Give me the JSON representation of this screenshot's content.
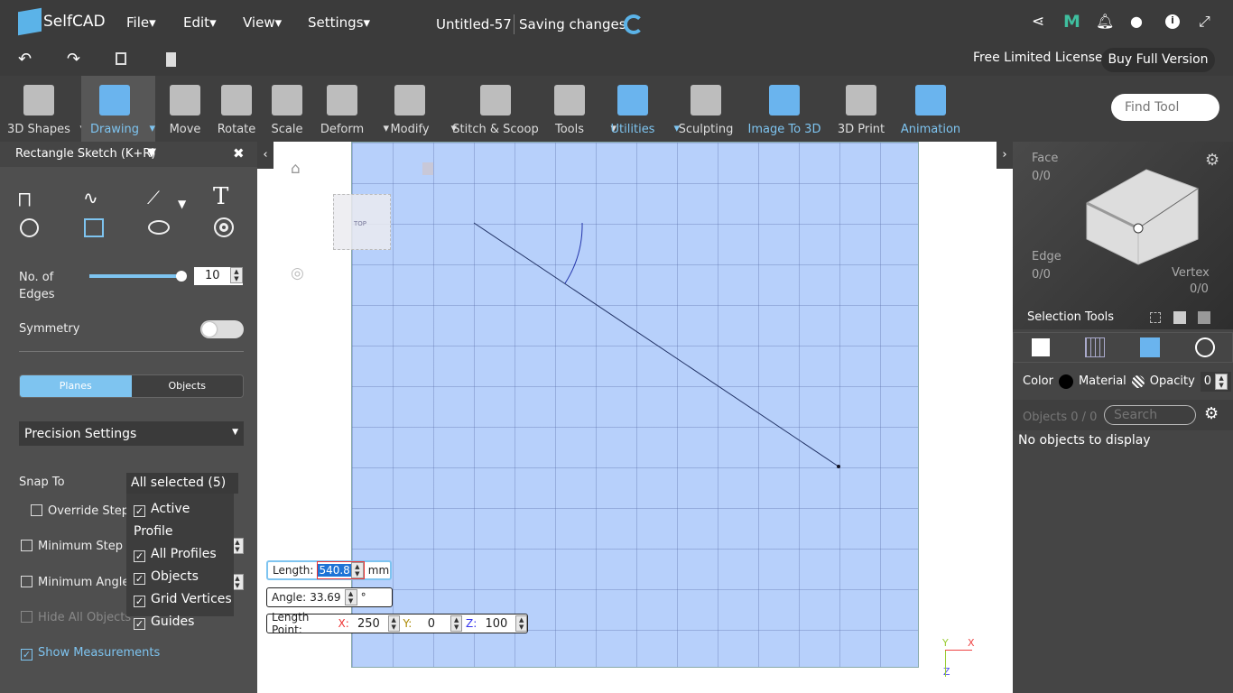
{
  "app": {
    "logo": "SelfCAD",
    "doc_title": "Untitled-57",
    "status": "Saving changes"
  },
  "menus": [
    "File",
    "Edit",
    "View",
    "Settings"
  ],
  "license": {
    "text": "Free Limited License",
    "buy": "Buy Full Version"
  },
  "toolbar": [
    {
      "label": "3D Shapes",
      "dd": true,
      "icon": "cube-icon",
      "blue": false
    },
    {
      "label": "Drawing",
      "dd": true,
      "icon": "drawing-icon",
      "blue": true,
      "active": true
    },
    {
      "label": "Move",
      "icon": "move-icon"
    },
    {
      "label": "Rotate",
      "icon": "rotate-icon"
    },
    {
      "label": "Scale",
      "icon": "scale-icon"
    },
    {
      "label": "Deform",
      "dd": true,
      "icon": "deform-icon"
    },
    {
      "label": "Modify",
      "dd": true,
      "icon": "modify-icon"
    },
    {
      "label": "Stitch & Scoop",
      "icon": "stitch-scoop-icon"
    },
    {
      "label": "Tools",
      "dd": true,
      "icon": "tools-icon"
    },
    {
      "label": "Utilities",
      "dd": true,
      "icon": "utilities-icon",
      "blue": true
    },
    {
      "label": "Sculpting",
      "icon": "sculpting-icon"
    },
    {
      "label": "Image To 3D",
      "icon": "image-to-3d-icon",
      "blue": true
    },
    {
      "label": "3D Print",
      "icon": "3d-print-icon"
    },
    {
      "label": "Animation",
      "icon": "animation-icon",
      "blue": true
    }
  ],
  "find_tool_placeholder": "Find Tool",
  "panel": {
    "title": "Rectangle Sketch (K+R)",
    "edges_label": "No. of Edges",
    "edges_value": "10",
    "edges_slider_fraction": 1.0,
    "symmetry": "Symmetry",
    "symmetry_on": false,
    "tabs": [
      "Planes",
      "Objects"
    ],
    "precision": "Precision Settings",
    "snap_to": "Snap To",
    "snap_value": "All selected (5)",
    "snap_options": [
      "Active Profile",
      "All Profiles",
      "Objects",
      "Grid Vertices",
      "Guides"
    ],
    "override": "Override Step",
    "min_step": "Minimum Step S",
    "min_angle": "Minimum Angle",
    "hide_all": "Hide All Objects",
    "show_meas": "Show Measurements"
  },
  "viewcube_label": "TOP",
  "measure": {
    "length_label": "Length:",
    "length_value": "540.8",
    "length_unit": "mm",
    "angle_label": "Angle:",
    "angle_value": "33.69",
    "angle_unit": "°",
    "point_label": "Length Point:",
    "x_label": "X:",
    "x": "250",
    "y_label": "Y:",
    "y": "0",
    "z_label": "Z:",
    "z": "100"
  },
  "axes": {
    "y": "Y",
    "x": "X",
    "z": "Z"
  },
  "right": {
    "face": "Face",
    "face_val": "0/0",
    "edge": "Edge",
    "edge_val": "0/0",
    "vertex": "Vertex",
    "vertex_val": "0/0",
    "selection_tools": "Selection Tools",
    "color": "Color",
    "material": "Material",
    "opacity": "Opacity",
    "opacity_val": "0",
    "objects": "Objects 0 / 0",
    "search_placeholder": "Search",
    "empty": "No objects to display"
  },
  "colors": {
    "accent": "#7ec4f0",
    "grid": "#b7d0fb"
  }
}
